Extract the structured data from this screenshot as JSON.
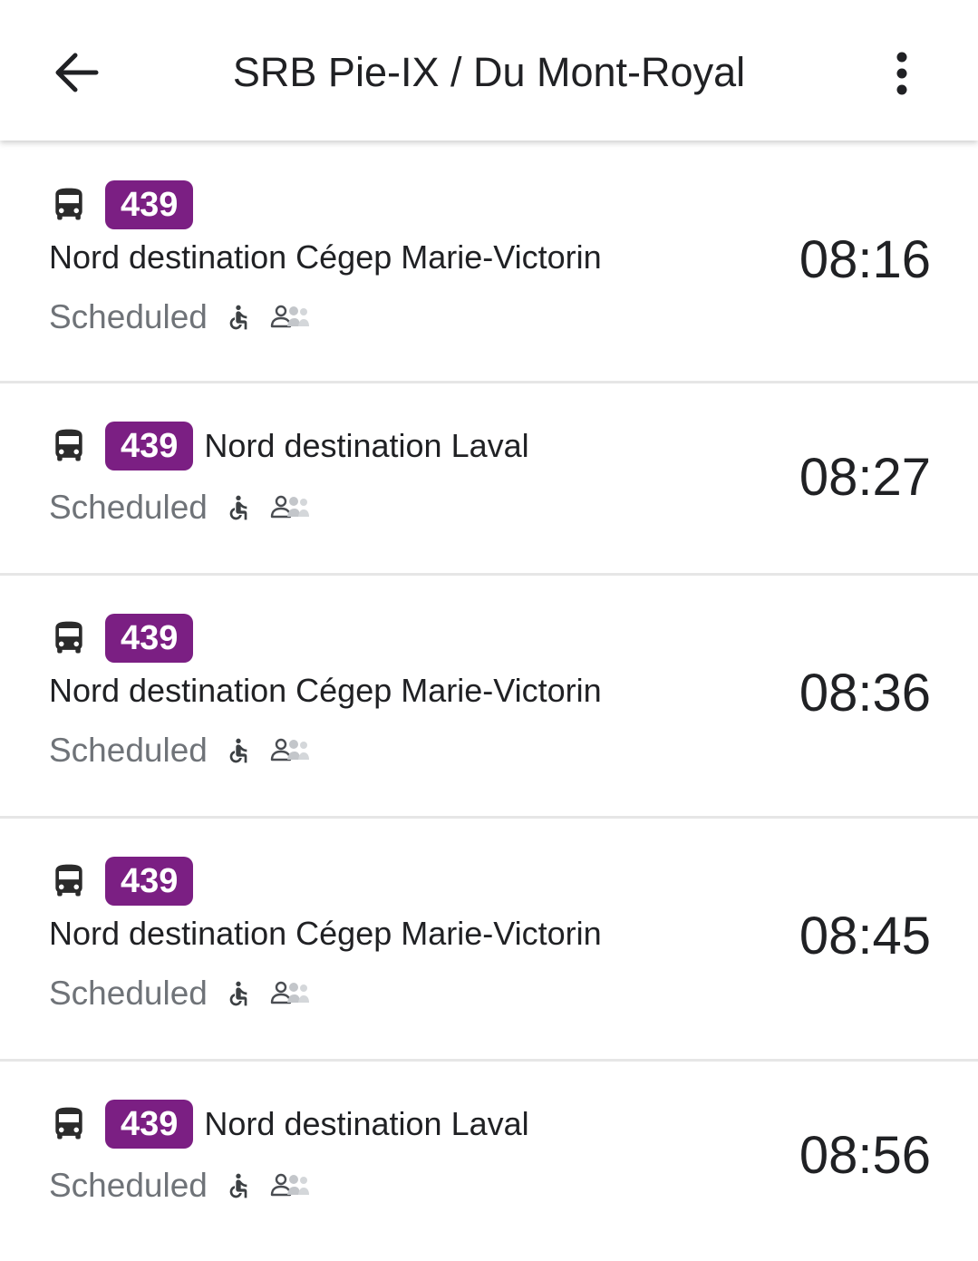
{
  "app_bar": {
    "title": "SRB Pie-IX / Du Mont-Royal",
    "back_icon": "arrow-back-icon",
    "menu_icon": "more-vert-icon"
  },
  "colors": {
    "route_badge": "#7b1f83",
    "status_text": "#6f7378"
  },
  "departures": [
    {
      "route": "439",
      "destination": "Nord destination Cégep Marie-Victorin",
      "status": "Scheduled",
      "time": "08:16"
    },
    {
      "route": "439",
      "destination": "Nord destination Laval",
      "status": "Scheduled",
      "time": "08:27"
    },
    {
      "route": "439",
      "destination": "Nord destination Cégep Marie-Victorin",
      "status": "Scheduled",
      "time": "08:36"
    },
    {
      "route": "439",
      "destination": "Nord destination Cégep Marie-Victorin",
      "status": "Scheduled",
      "time": "08:45"
    },
    {
      "route": "439",
      "destination": "Nord destination Laval",
      "status": "Scheduled",
      "time": "08:56"
    }
  ]
}
